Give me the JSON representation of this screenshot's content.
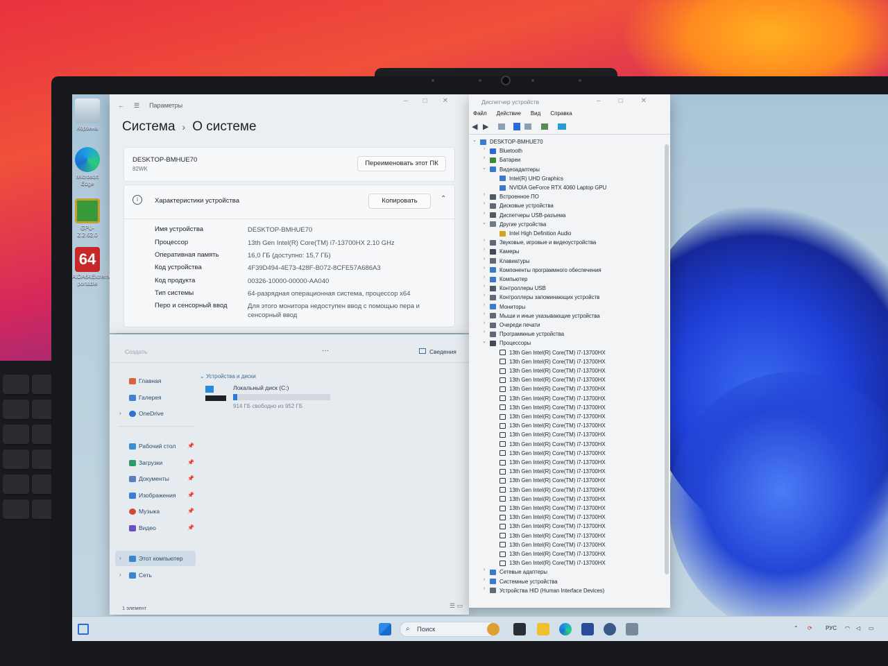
{
  "desktop": {
    "icons": [
      {
        "label": "Корзина",
        "icon": "recycle-bin-icon"
      },
      {
        "label": "Microsoft Edge",
        "icon": "edge-icon"
      },
      {
        "label": "GPU-Z.2.62.0",
        "icon": "gpu-z-icon"
      },
      {
        "label": "AIDA64Extreme-portable",
        "icon": "aida64-icon"
      }
    ],
    "aida_badge": "64"
  },
  "settings": {
    "window_title": "Параметры",
    "breadcrumb_parent": "Система",
    "breadcrumb_sep": "›",
    "breadcrumb_current": "О системе",
    "device_name": "DESKTOP-BMHUE70",
    "device_model": "82WK",
    "rename_button": "Переименовать этот ПК",
    "specs_title": "Характеристики устройства",
    "copy_button": "Копировать",
    "specs": [
      {
        "label": "Имя устройства",
        "value": "DESKTOP-BMHUE70"
      },
      {
        "label": "Процессор",
        "value": "13th Gen Intel(R) Core(TM) i7-13700HX   2.10 GHz"
      },
      {
        "label": "Оперативная память",
        "value": "16,0 ГБ (доступно: 15,7 ГБ)"
      },
      {
        "label": "Код устройства",
        "value": "4F39D494-4E73-428F-B072-8CFE57A686A3"
      },
      {
        "label": "Код продукта",
        "value": "00326-10000-00000-AA040"
      },
      {
        "label": "Тип системы",
        "value": "64-разрядная операционная система, процессор x64"
      },
      {
        "label": "Перо и сенсорный ввод",
        "value": "Для этого монитора недоступен ввод с помощью пера и сенсорный ввод"
      }
    ]
  },
  "explorer": {
    "create_button": "Создать",
    "more_button": "···",
    "details_button": "Сведения",
    "nav": [
      {
        "label": "Главная",
        "icon": "home-icon",
        "color": "#d9623a"
      },
      {
        "label": "Галерея",
        "icon": "gallery-icon",
        "color": "#3f7fd4"
      },
      {
        "label": "OneDrive",
        "icon": "onedrive-icon",
        "color": "#2e77d0"
      },
      {
        "label": "Рабочий стол",
        "icon": "desktop-folder-icon",
        "color": "#3b8fd8"
      },
      {
        "label": "Загрузки",
        "icon": "downloads-icon",
        "color": "#2a9d6a"
      },
      {
        "label": "Документы",
        "icon": "documents-icon",
        "color": "#5a7fbf"
      },
      {
        "label": "Изображения",
        "icon": "pictures-icon",
        "color": "#3c7ed6"
      },
      {
        "label": "Музыка",
        "icon": "music-icon",
        "color": "#d2483a"
      },
      {
        "label": "Видео",
        "icon": "videos-icon",
        "color": "#6a4fc8"
      },
      {
        "label": "Этот компьютер",
        "icon": "this-pc-icon",
        "color": "#3c86d0"
      },
      {
        "label": "Сеть",
        "icon": "network-icon",
        "color": "#3c86d0"
      }
    ],
    "section_title": "Устройства и диски",
    "drive_name": "Локальный диск (C:)",
    "drive_free": "914 ГБ свободно из 952 ГБ",
    "drive_used_fraction": 0.04,
    "status": "1 элемент"
  },
  "device_manager": {
    "window_title": "Диспетчер устройств",
    "menu": [
      "Файл",
      "Действие",
      "Вид",
      "Справка"
    ],
    "root": "DESKTOP-BMHUE70",
    "items": [
      {
        "level": 1,
        "label": "Bluetooth",
        "expanded": false,
        "color": "#2a6ad8"
      },
      {
        "level": 1,
        "label": "Батареи",
        "expanded": false,
        "color": "#3a8a3a"
      },
      {
        "level": 1,
        "label": "Видеоадаптеры",
        "expanded": true,
        "color": "#3a7ac8"
      },
      {
        "level": 2,
        "label": "Intel(R) UHD Graphics",
        "color": "#3a7ac8"
      },
      {
        "level": 2,
        "label": "NVIDIA GeForce RTX 4060 Laptop GPU",
        "color": "#3a7ac8"
      },
      {
        "level": 1,
        "label": "Встроенное ПО",
        "expanded": false,
        "color": "#505a66"
      },
      {
        "level": 1,
        "label": "Дисковые устройства",
        "expanded": false,
        "color": "#606a76"
      },
      {
        "level": 1,
        "label": "Диспетчеры USB-разъема",
        "expanded": false,
        "color": "#505a66"
      },
      {
        "level": 1,
        "label": "Другие устройства",
        "expanded": true,
        "color": "#707a86"
      },
      {
        "level": 2,
        "label": "Intel High Definition Audio",
        "color": "#d8a020"
      },
      {
        "level": 1,
        "label": "Звуковые, игровые и видеоустройства",
        "expanded": false,
        "color": "#606a76"
      },
      {
        "level": 1,
        "label": "Камеры",
        "expanded": false,
        "color": "#404a56"
      },
      {
        "level": 1,
        "label": "Клавиатуры",
        "expanded": false,
        "color": "#606a76"
      },
      {
        "level": 1,
        "label": "Компоненты программного обеспечения",
        "expanded": false,
        "color": "#3a7ac8"
      },
      {
        "level": 1,
        "label": "Компьютер",
        "expanded": false,
        "color": "#3a7ac8"
      },
      {
        "level": 1,
        "label": "Контроллеры USB",
        "expanded": false,
        "color": "#505a66"
      },
      {
        "level": 1,
        "label": "Контроллеры запоминающих устройств",
        "expanded": false,
        "color": "#606a76"
      },
      {
        "level": 1,
        "label": "Мониторы",
        "expanded": false,
        "color": "#3a7ac8"
      },
      {
        "level": 1,
        "label": "Мыши и иные указывающие устройства",
        "expanded": false,
        "color": "#606a76"
      },
      {
        "level": 1,
        "label": "Очереди печати",
        "expanded": false,
        "color": "#606a76"
      },
      {
        "level": 1,
        "label": "Программные устройства",
        "expanded": false,
        "color": "#606a76"
      },
      {
        "level": 1,
        "label": "Процессоры",
        "expanded": true,
        "color": "#404a56"
      }
    ],
    "processor_label": "13th Gen Intel(R) Core(TM) i7-13700HX",
    "processor_count": 24,
    "tail_items": [
      {
        "level": 1,
        "label": "Сетевые адаптеры",
        "expanded": false,
        "color": "#3a7ac8"
      },
      {
        "level": 1,
        "label": "Системные устройства",
        "expanded": false,
        "color": "#3a7ac8"
      },
      {
        "level": 1,
        "label": "Устройства HID (Human Interface Devices)",
        "expanded": false,
        "color": "#606a76"
      }
    ]
  },
  "taskbar": {
    "search_placeholder": "Поиск",
    "lang": "РУС"
  }
}
